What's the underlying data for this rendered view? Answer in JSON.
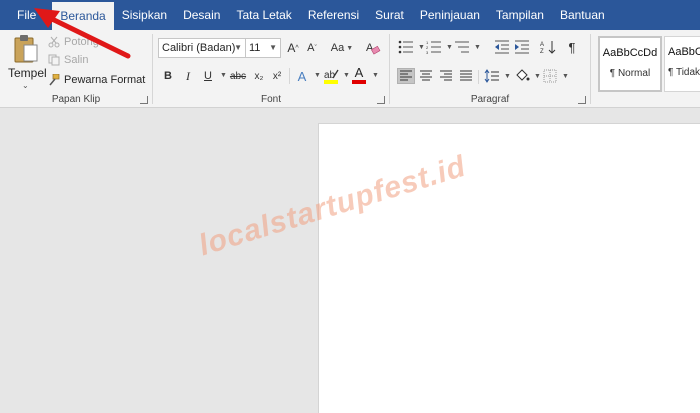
{
  "tabs": [
    "File",
    "Beranda",
    "Sisipkan",
    "Desain",
    "Tata Letak",
    "Referensi",
    "Surat",
    "Peninjauan",
    "Tampilan",
    "Bantuan"
  ],
  "active_tab": "Beranda",
  "clipboard": {
    "paste_label": "Tempel",
    "cut_label": "Potong",
    "copy_label": "Salin",
    "format_painter_label": "Pewarna Format",
    "group_label": "Papan Klip"
  },
  "font": {
    "family": "Calibri (Badan)",
    "size": "11",
    "grow_label": "A",
    "shrink_label": "A",
    "case_label": "Aa",
    "bold": "B",
    "italic": "I",
    "underline": "U",
    "strike": "abc",
    "subscript": "x₂",
    "superscript": "x²",
    "effects": "A",
    "color_letter": "A",
    "group_label": "Font",
    "highlight_color": "#ffff00",
    "font_color": "#e00000"
  },
  "paragraph": {
    "group_label": "Paragraf",
    "pilcrow": "¶"
  },
  "styles": [
    {
      "sample": "AaBbCcDd",
      "name": "¶ Normal",
      "selected": true
    },
    {
      "sample": "AaBbCcDd",
      "name": "¶ Tidak",
      "selected": false
    }
  ],
  "watermark": "localstartupfest.id",
  "colors": {
    "accent": "#2b579a",
    "ribbon": "#f3f3f3",
    "workspace": "#e6e6e6",
    "arrow": "#e01818"
  }
}
